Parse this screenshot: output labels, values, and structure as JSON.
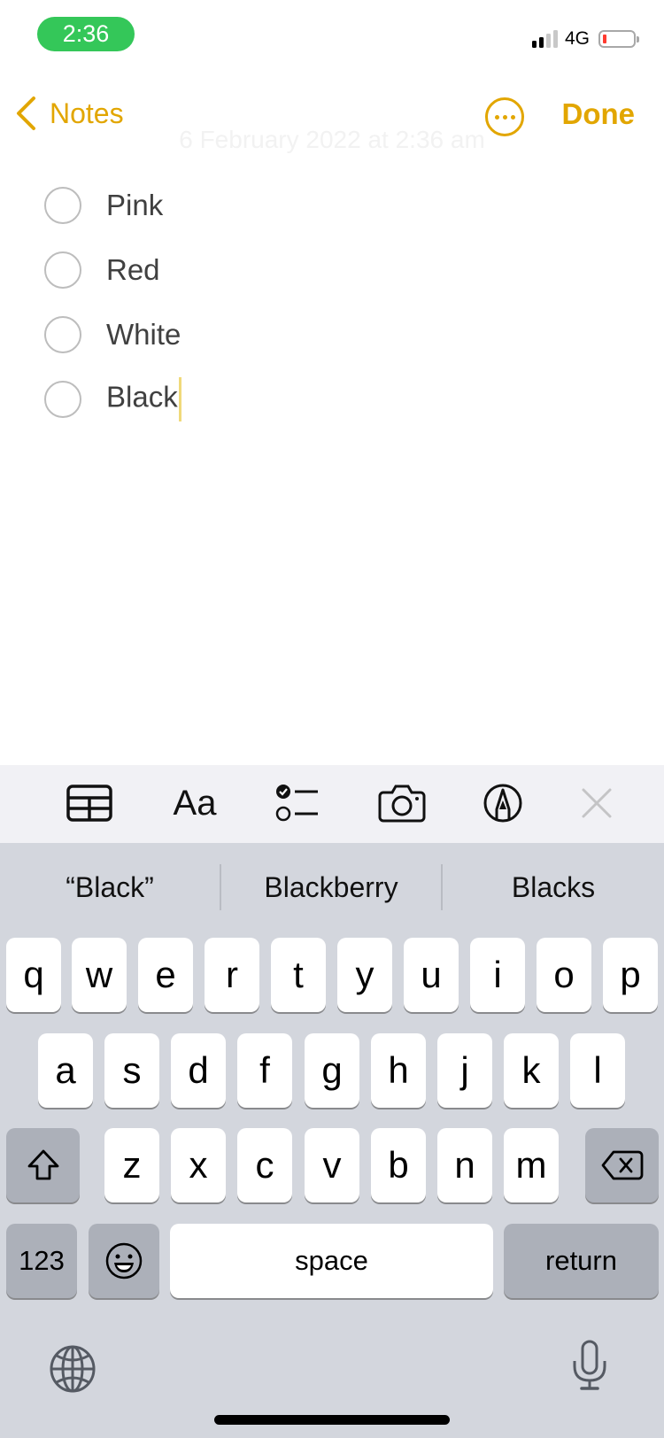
{
  "status_bar": {
    "time": "2:36",
    "network": "4G",
    "signal_bars_active": 2,
    "signal_bars_total": 4,
    "battery_level": "low",
    "time_pill_color": "#34c759",
    "battery_color": "#ff3b30"
  },
  "nav": {
    "back_label": "Notes",
    "done_label": "Done",
    "more_icon": "ellipsis-circle-icon",
    "accent_color": "#e2a600"
  },
  "note": {
    "date": "6 February 2022 at 2:36 am",
    "checklist": [
      {
        "text": "Pink",
        "checked": false
      },
      {
        "text": "Red",
        "checked": false
      },
      {
        "text": "White",
        "checked": false
      },
      {
        "text": "Black",
        "checked": false,
        "has_cursor": true
      }
    ]
  },
  "toolbar": {
    "items": [
      {
        "name": "table",
        "icon": "table-icon"
      },
      {
        "name": "format",
        "label": "Aa",
        "icon": "text-format-icon"
      },
      {
        "name": "checklist",
        "icon": "checklist-icon"
      },
      {
        "name": "camera",
        "icon": "camera-icon"
      },
      {
        "name": "markup",
        "icon": "markup-pen-icon"
      },
      {
        "name": "close",
        "icon": "close-icon"
      }
    ]
  },
  "keyboard": {
    "suggestions": [
      "“Black”",
      "Blackberry",
      "Blacks"
    ],
    "row1": [
      "q",
      "w",
      "e",
      "r",
      "t",
      "y",
      "u",
      "i",
      "o",
      "p"
    ],
    "row2": [
      "a",
      "s",
      "d",
      "f",
      "g",
      "h",
      "j",
      "k",
      "l"
    ],
    "row3": [
      "z",
      "x",
      "c",
      "v",
      "b",
      "n",
      "m"
    ],
    "numbers_label": "123",
    "space_label": "space",
    "return_label": "return",
    "shift_icon": "shift-icon",
    "delete_icon": "backspace-icon",
    "emoji_icon": "emoji-icon",
    "globe_icon": "globe-icon",
    "mic_icon": "microphone-icon"
  }
}
